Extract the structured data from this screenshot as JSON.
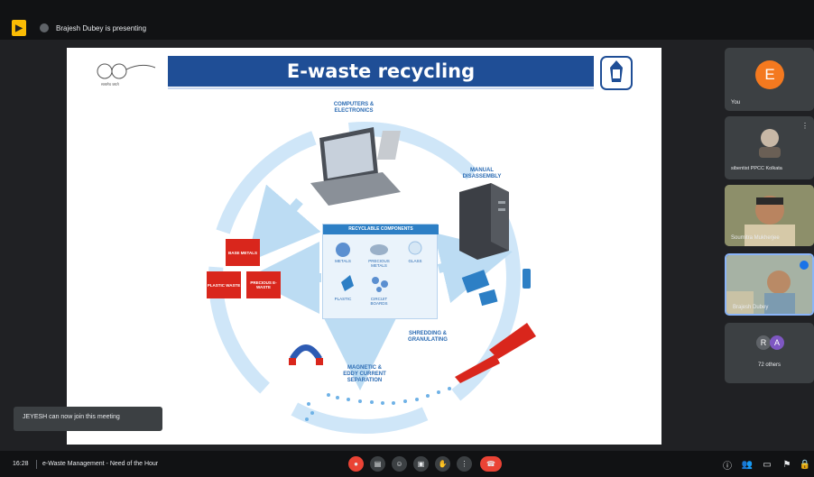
{
  "topbar": {
    "presenting_text": "Brajesh Dubey is presenting"
  },
  "slide": {
    "title": "E-waste recycling",
    "left_logo_caption": "सत्यमेव जयते",
    "labels": {
      "computers": "COMPUTERS &\nELECTRONICS",
      "disassembly": "MANUAL\nDISASSEMBLY",
      "shredding": "SHREDDING &\nGRANULATING",
      "magnetic": "MAGNETIC &\nEDDY CURRENT\nSEPARATION"
    },
    "recyclable": {
      "title": "RECYCLABLE COMPONENTS",
      "items": [
        "METALS",
        "PRECIOUS METALS",
        "GLASS",
        "PLASTIC",
        "CIRCUIT BOARDS"
      ]
    },
    "outputs": {
      "base_metals": "BASE METALS",
      "plastic_waste": "PLASTIC WASTE",
      "precious_e_waste": "PRECIOUS E-WASTE"
    }
  },
  "toast": {
    "text": "JEYESH can now join this meeting"
  },
  "participants": {
    "you": {
      "initial": "E",
      "name": "You",
      "color": "#f4791f"
    },
    "p2": {
      "name": "sibentist PPCC Kolkata"
    },
    "p3": {
      "name": "Soumitra Mukherjee"
    },
    "p4": {
      "name": "Brajesh Dubey"
    },
    "others": {
      "initials": [
        "R",
        "A"
      ],
      "label": "72 others",
      "colors": [
        "#5f6368",
        "#7e57c2"
      ]
    }
  },
  "bottombar": {
    "time": "16:28",
    "meeting_title": "e-Waste Management - Need of the Hour"
  },
  "icons": {
    "mic": "mic-off-icon",
    "camera": "camera-icon",
    "captions": "captions-icon",
    "raise_hand": "raise-hand-icon",
    "present": "present-icon",
    "more": "more-vert-icon",
    "end": "end-call-icon",
    "info": "info-icon",
    "people": "people-icon",
    "chat": "chat-icon",
    "activities": "activities-icon",
    "lock": "host-controls-icon"
  }
}
